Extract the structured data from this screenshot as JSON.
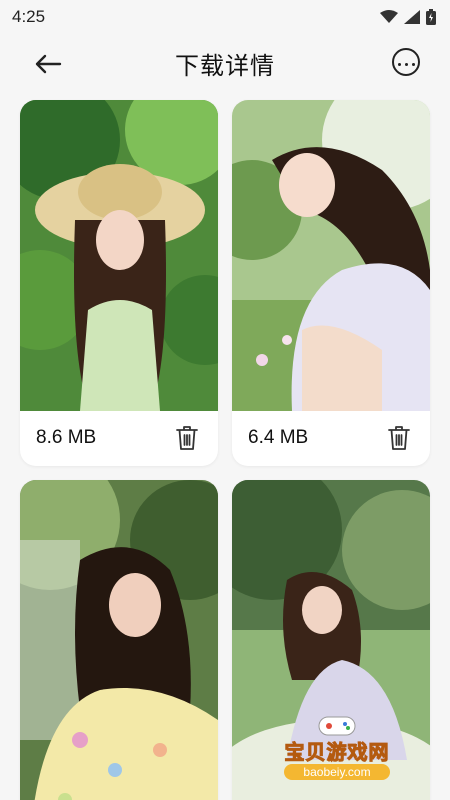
{
  "status_bar": {
    "time": "4:25"
  },
  "header": {
    "title": "下载详情"
  },
  "cards": [
    {
      "size": "8.6 MB"
    },
    {
      "size": "6.4 MB"
    }
  ],
  "watermark": {
    "text": "宝贝游戏网",
    "url": "baobeiy.com"
  },
  "colors": {
    "background": "#f6f6f6",
    "card": "#ffffff",
    "watermark": "#f0a020"
  }
}
